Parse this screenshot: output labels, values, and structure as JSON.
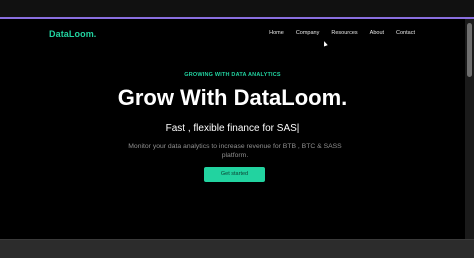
{
  "header": {
    "logo": "DataLoom.",
    "nav": [
      "Home",
      "Company",
      "Resources",
      "About",
      "Contact"
    ]
  },
  "hero": {
    "eyebrow": "GROWING WITH DATA ANALYTICS",
    "headline": "Grow With DataLoom.",
    "subhead": "Fast , flexible finance for SAS|",
    "description": "Monitor your data analytics to increase revenue for BTB , BTC & SASS platform.",
    "cta_label": "Get started"
  },
  "colors": {
    "accent": "#22d3a0",
    "background": "#000000",
    "window_accent_line": "#8a6fe0"
  }
}
